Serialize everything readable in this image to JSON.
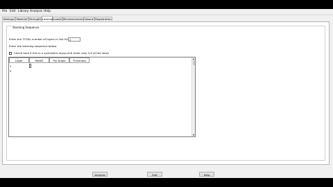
{
  "menu": [
    "File",
    "Edit",
    "Library",
    "Analysis",
    "Help"
  ],
  "tabs": [
    "Settings",
    "Material",
    "Strength",
    "Laminat",
    "Loads",
    "Micromechanics",
    "About",
    "Registration"
  ],
  "active_tab": "Laminat",
  "group_title": "Stacking Sequence",
  "total_layers_label": "Enter the TOTAL number of layers in the full stack",
  "total_layers_value": "2",
  "stacking_prompt": "Enter the stacking sequence below",
  "symmetric_label": "Check here if this is a symmetric layup and enter only 1/2 of the stack",
  "table": {
    "headers": [
      "Layer",
      "MatID",
      "Ply Angle",
      "Thickness"
    ],
    "rows": [
      "1",
      "2"
    ]
  },
  "buttons": {
    "analyze": "Analyze",
    "exit": "Exit",
    "help": "Help"
  }
}
